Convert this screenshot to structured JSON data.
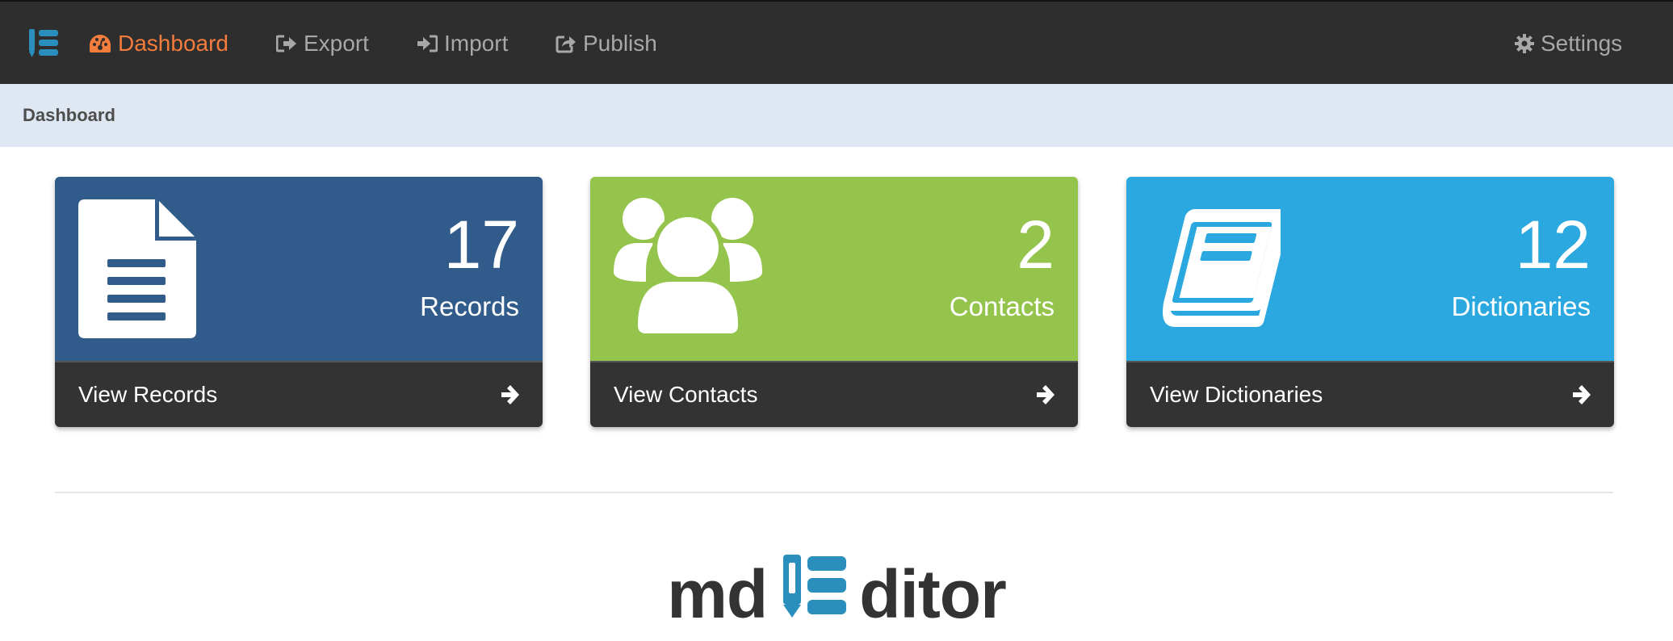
{
  "nav": {
    "items": [
      {
        "label": "Dashboard",
        "icon": "dashboard-icon",
        "active": true
      },
      {
        "label": "Export",
        "icon": "export-icon"
      },
      {
        "label": "Import",
        "icon": "import-icon"
      },
      {
        "label": "Publish",
        "icon": "publish-icon"
      }
    ],
    "settings": {
      "label": "Settings",
      "icon": "gear-icon"
    }
  },
  "breadcrumb": {
    "title": "Dashboard"
  },
  "panels": [
    {
      "count": "17",
      "label": "Records",
      "link": "View Records",
      "icon": "file-icon",
      "color": "#315b8b"
    },
    {
      "count": "2",
      "label": "Contacts",
      "link": "View Contacts",
      "icon": "users-icon",
      "color": "#95c44d"
    },
    {
      "count": "12",
      "label": "Dictionaries",
      "link": "View Dictionaries",
      "icon": "book-icon",
      "color": "#2aa8df"
    }
  ],
  "brand": {
    "left": "md",
    "right": "ditor",
    "logo_color": "#2a8fbd"
  },
  "colors": {
    "navbar": "#2e2e2e",
    "active": "#f47c3c",
    "nav_text": "#a8a8a8",
    "breadcrumb_bg": "#dfe8f2",
    "panel_footer": "#333333"
  }
}
